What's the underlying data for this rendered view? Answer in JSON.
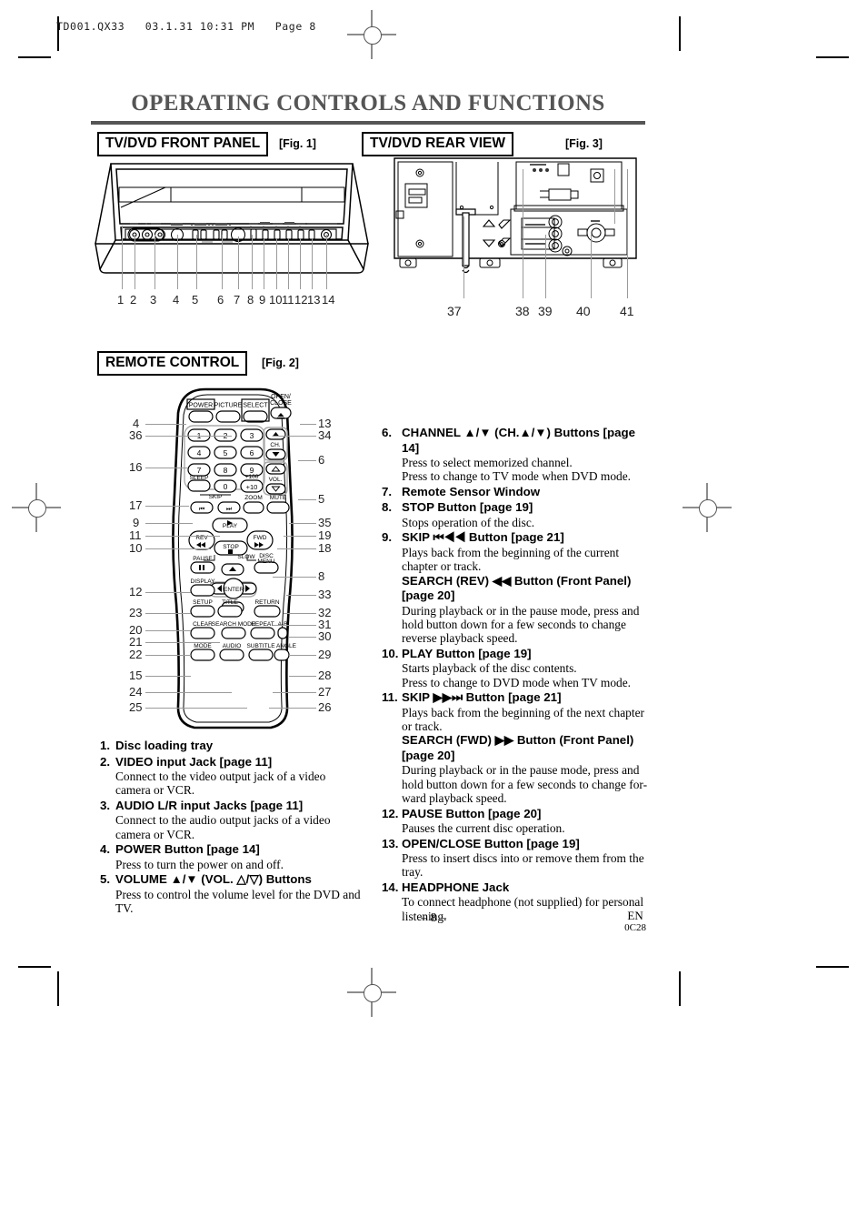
{
  "print_slug": "TD001.QX33   03.1.31 10:31 PM   Page 8",
  "title": "OPERATING CONTROLS AND FUNCTIONS",
  "sections": {
    "front_panel": {
      "heading": "TV/DVD FRONT PANEL",
      "figure": "[Fig. 1]"
    },
    "rear_view": {
      "heading": "TV/DVD REAR VIEW",
      "figure": "[Fig. 3]"
    },
    "remote": {
      "heading": "REMOTE CONTROL",
      "figure": "[Fig. 2]"
    }
  },
  "callouts": {
    "front_panel": [
      "1",
      "2",
      "3",
      "4",
      "5",
      "6",
      "7",
      "8",
      "9",
      "10",
      "11",
      "12",
      "13",
      "14"
    ],
    "rear_view": [
      "37",
      "38",
      "39",
      "40",
      "41"
    ],
    "remote_left": [
      "4",
      "36",
      "16",
      "17",
      "9",
      "11",
      "10",
      "12",
      "23",
      "20",
      "21",
      "22",
      "15",
      "24",
      "25"
    ],
    "remote_right": [
      "13",
      "34",
      "6",
      "5",
      "35",
      "19",
      "18",
      "8",
      "33",
      "32",
      "31",
      "30",
      "29",
      "28",
      "27",
      "26"
    ]
  },
  "remote_buttons": [
    "POWER",
    "PICTURE",
    "SELECT",
    "OPEN/CLOSE",
    "1",
    "2",
    "3",
    "4",
    "5",
    "6",
    "7",
    "8",
    "9",
    "0",
    "+100",
    "+10",
    "CH.",
    "VOL.",
    "SLEEP",
    "SKIP",
    "ZOOM",
    "MUTE",
    "PLAY",
    "REV",
    "FWD",
    "STOP",
    "PAUSE",
    "SLOW",
    "DISC MENU",
    "DISPLAY",
    "ENTER",
    "SETUP",
    "TITLE",
    "RETURN",
    "CLEAR",
    "SEARCH MODE",
    "REPEAT",
    "A-B",
    "MODE",
    "AUDIO",
    "SUBTITLE",
    "ANGLE"
  ],
  "left_column": [
    {
      "num": "1.",
      "heading": "Disc loading tray",
      "desc": []
    },
    {
      "num": "2.",
      "heading": "VIDEO input Jack [page 11]",
      "desc": [
        "Connect to the video output jack of a video",
        "camera or VCR."
      ]
    },
    {
      "num": "3.",
      "heading": "AUDIO L/R input Jacks [page 11]",
      "desc": [
        "Connect to the audio output jacks of a video",
        "camera or VCR."
      ]
    },
    {
      "num": "4.",
      "heading": "POWER Button [page 14]",
      "desc": [
        "Press to turn the power on and off."
      ]
    },
    {
      "num": "5.",
      "heading": "VOLUME ▲/▼ (VOL. △/▽) Buttons",
      "desc": [
        "Press to control the volume level for the DVD and TV."
      ]
    }
  ],
  "right_column": [
    {
      "num": "6.",
      "heading": "CHANNEL ▲/▼ (CH.▲/▼) Buttons [page 14]",
      "desc": [
        "Press to select memorized channel.",
        "Press to change to TV mode when DVD mode."
      ]
    },
    {
      "num": "7.",
      "heading": "Remote Sensor Window",
      "desc": []
    },
    {
      "num": "8.",
      "heading": "STOP Button [page 19]",
      "desc": [
        "Stops operation of the disc."
      ]
    },
    {
      "num": "9.",
      "heading": "SKIP ⏮◀◀ Button  [page 21]",
      "desc": [
        "Plays back from the beginning of the current",
        "chapter or track."
      ],
      "subheading": [
        "SEARCH (REV) ◀◀ Button (Front Panel)",
        "[page 20]"
      ],
      "subdesc": [
        "During playback or in the pause mode, press and",
        "hold button down for a few seconds to change",
        "reverse playback speed."
      ]
    },
    {
      "num": "10.",
      "heading": "PLAY Button [page 19]",
      "desc": [
        "Starts playback of the disc contents.",
        "Press to change to DVD mode when TV mode."
      ]
    },
    {
      "num": "11.",
      "heading": "SKIP ▶▶⏭ Button [page 21]",
      "desc": [
        "Plays back from the beginning of the next chapter",
        "or track."
      ],
      "subheading": [
        "SEARCH (FWD) ▶▶ Button (Front Panel)",
        "[page 20]"
      ],
      "subdesc": [
        "During playback or in the pause mode, press and",
        "hold button down for a few seconds to change for-",
        "ward playback speed."
      ]
    },
    {
      "num": "12.",
      "heading": "PAUSE Button [page 20]",
      "desc": [
        "Pauses the current disc operation."
      ]
    },
    {
      "num": "13.",
      "heading": "OPEN/CLOSE Button [page 19]",
      "desc": [
        "Press to insert discs into or remove them from the",
        "tray."
      ]
    },
    {
      "num": "14.",
      "heading": "HEADPHONE Jack",
      "desc": [
        "To connect headphone (not supplied) for personal",
        "listening."
      ]
    }
  ],
  "footer": {
    "page": "– 8 –",
    "region": "EN",
    "code": "0C28"
  }
}
